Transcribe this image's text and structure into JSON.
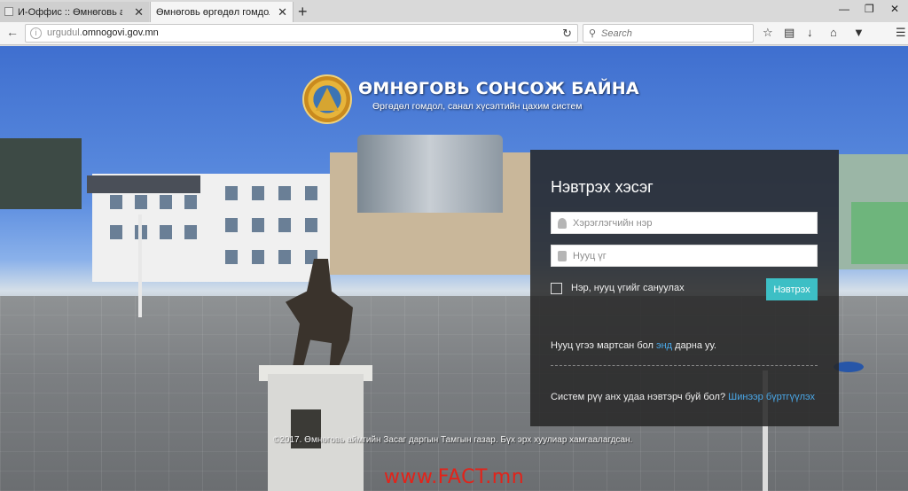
{
  "browser": {
    "tabs": [
      {
        "title": "И-Оффис :: Өмнөговь айма",
        "active": false
      },
      {
        "title": "Өмнөговь өргөдөл гомдол, сан",
        "active": true
      }
    ],
    "new_tab": "+",
    "close_glyph": "✕",
    "window_controls": [
      "—",
      "❐",
      "✕"
    ],
    "url_prefix": "urgudul.",
    "url_domain": "omnogovi.gov.mn",
    "search_placeholder": "Search"
  },
  "header": {
    "title": "ӨМНӨГОВЬ СОНСОЖ БАЙНА",
    "subtitle": "Өргөдөл гомдол, санал хүсэлтийн цахим систем"
  },
  "login": {
    "title": "Нэвтрэх хэсэг",
    "username_placeholder": "Хэрэглэгчийн нэр",
    "password_placeholder": "Нууц үг",
    "remember_label": "Нэр, нууц үгийг сануулах",
    "submit_label": "Нэвтрэх",
    "forgot_prefix": "Нууц үгээ мартсан бол ",
    "forgot_link": "энд",
    "forgot_suffix": " дарна уу.",
    "register_prefix": "Систем рүү анх удаа нэвтэрч буй бол? ",
    "register_link": "Шинээр бүртгүүлэх"
  },
  "footer": {
    "copyright": "©2017. Өмнөговь аймгийн Засаг даргын Тамгын газар. Бүх эрх хуулиар хамгаалагдсан.",
    "watermark": "www.FACT.mn"
  },
  "colors": {
    "accent": "#3dbfc5",
    "link": "#4aa8e8",
    "panel": "#262626",
    "watermark": "#e2231a"
  }
}
